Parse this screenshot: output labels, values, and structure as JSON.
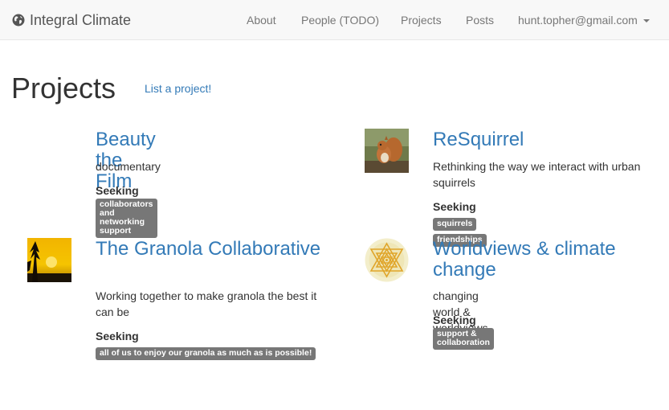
{
  "nav": {
    "brand": "Integral Climate",
    "links": [
      "About",
      "People (TODO)",
      "Projects",
      "Posts"
    ],
    "user": "hunt.topher@gmail.com"
  },
  "page": {
    "title": "Projects",
    "list_link": "List a project!"
  },
  "seeking_label": "Seeking",
  "projects": [
    {
      "title": "Beauty the Film",
      "description": "documentary",
      "tags": [
        "collaborators and networking support"
      ]
    },
    {
      "title": "ReSquirrel",
      "description": "Rethinking the way we interact with urban squirrels",
      "tags": [
        "squirrels",
        "friendships"
      ],
      "image": "squirrel-photo"
    },
    {
      "title": "The Granola Collaborative",
      "description": "Working together to make granola the best it can be",
      "tags": [
        "all of us to enjoy our granola as much as is possible!"
      ],
      "image": "sunset-tree-photo"
    },
    {
      "title": "Worldviews & climate change",
      "description": "changing world & worldviews",
      "tags": [
        "support & collaboration"
      ],
      "image": "sri-yantra-emblem"
    }
  ],
  "colors": {
    "link": "#337ab7",
    "tag_bg": "#777777",
    "navbar_bg": "#f8f8f8"
  }
}
